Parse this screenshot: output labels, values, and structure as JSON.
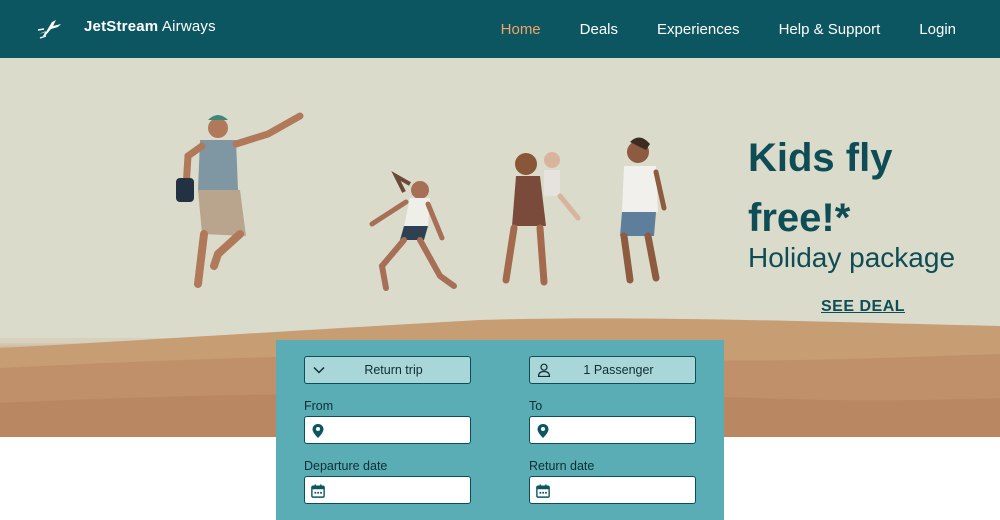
{
  "header": {
    "brand_bold": "JetStream",
    "brand_rest": " Airways",
    "logo_icon": "airplane-icon",
    "nav": [
      {
        "label": "Home",
        "active": true
      },
      {
        "label": "Deals",
        "active": false
      },
      {
        "label": "Experiences",
        "active": false
      },
      {
        "label": "Help & Support",
        "active": false
      },
      {
        "label": "Login",
        "active": false
      }
    ],
    "colors": {
      "bar": "#0b5660",
      "active": "#f2a368",
      "text": "#ffffff"
    }
  },
  "hero": {
    "title": "Kids fly free!*",
    "subtitle": "Holiday package",
    "cta": "SEE DEAL",
    "image_description_icon": "family-jumping-dunes-photo"
  },
  "booking": {
    "trip_type": "Return trip",
    "trip_type_icon": "chevron-down-icon",
    "passengers": "1 Passenger",
    "passengers_icon": "person-icon",
    "from_label": "From",
    "from_value": "",
    "to_label": "To",
    "to_value": "",
    "departure_label": "Departure date",
    "departure_value": "",
    "return_label": "Return date",
    "return_value": "",
    "location_icon": "map-pin-icon",
    "calendar_icon": "calendar-icon",
    "colors": {
      "panel": "#5aadb4",
      "select": "#a9d6d8",
      "border": "#0e4d55"
    }
  }
}
